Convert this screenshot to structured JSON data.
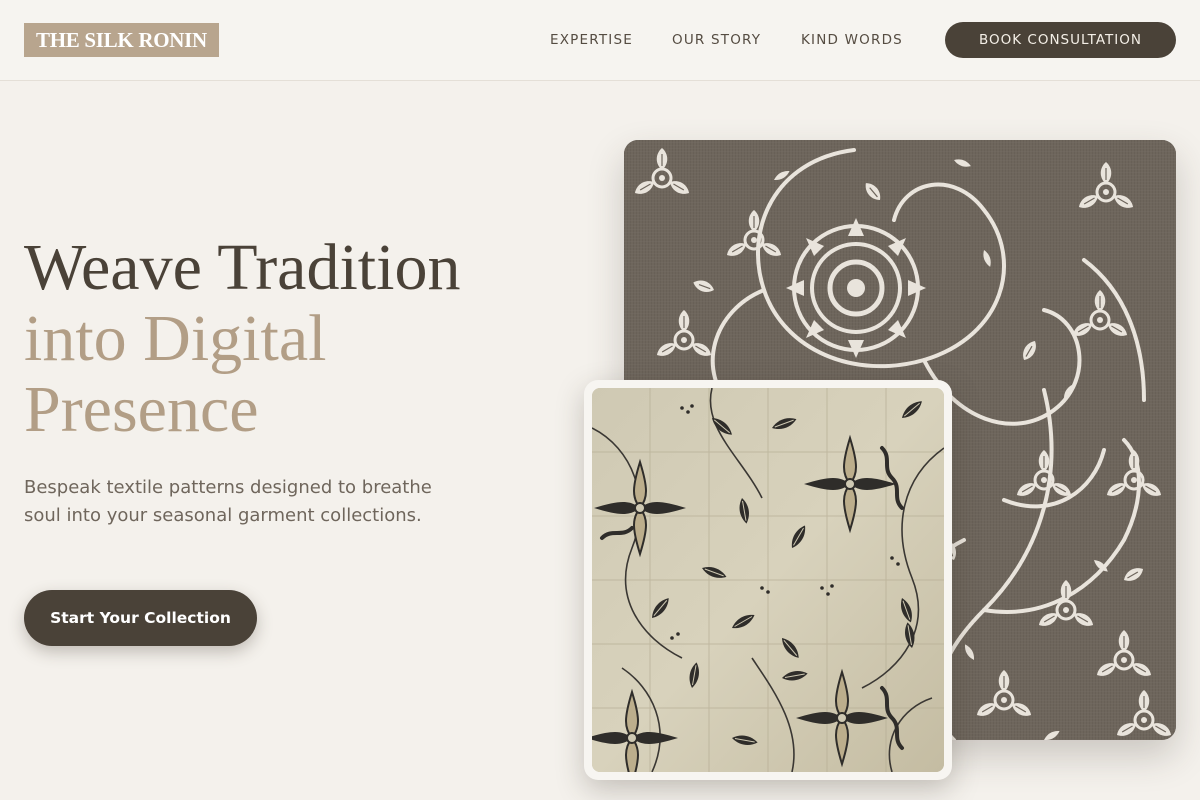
{
  "brand": {
    "logo_text": "THE SILK RONIN"
  },
  "nav": {
    "items": [
      {
        "label": "EXPERTISE"
      },
      {
        "label": "OUR STORY"
      },
      {
        "label": "KIND WORDS"
      }
    ],
    "cta_label": "BOOK CONSULTATION"
  },
  "hero": {
    "title_line1": "Weave Tradition",
    "title_line2": "into Digital",
    "title_line3": "Presence",
    "subtitle": "Bespeak textile patterns designed to breathe soul into your seasonal garment collections.",
    "cta_label": "Start Your Collection"
  },
  "images": {
    "back": {
      "icon": "floral-embroidery-pattern"
    },
    "front": {
      "icon": "batik-leaf-pattern"
    }
  },
  "colors": {
    "background": "#f4f1ec",
    "dark": "#4a4238",
    "accent": "#b29e86",
    "logo_bg": "#b8a58e"
  }
}
